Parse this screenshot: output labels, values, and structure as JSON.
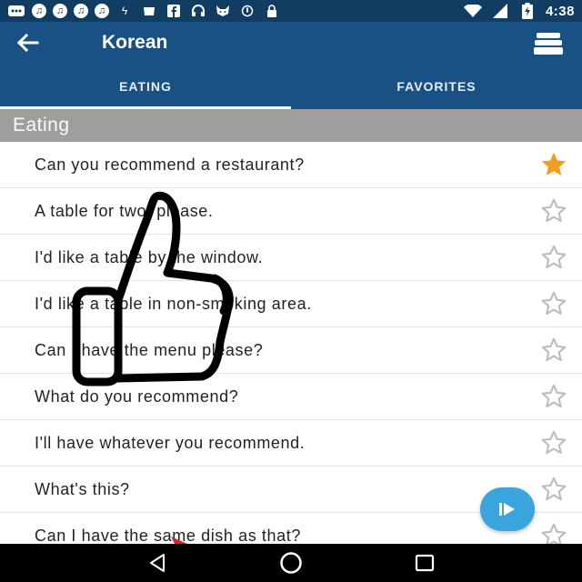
{
  "status_bar": {
    "time": "4:38",
    "icons": [
      "notification-icon",
      "music-icon",
      "music-icon",
      "music-icon",
      "music-icon",
      "usb-icon",
      "wallet-icon",
      "facebook-icon",
      "headset-icon",
      "cat-icon",
      "sync-icon",
      "lock-icon",
      "wifi-icon",
      "signal-icon",
      "battery-charging-icon"
    ]
  },
  "app_bar": {
    "title": "Korean",
    "back_icon": "arrow-back-icon",
    "menu_icon": "stack-icon"
  },
  "tabs": [
    {
      "label": "EATING",
      "active": true
    },
    {
      "label": "FAVORITES",
      "active": false
    }
  ],
  "section": {
    "title": "Eating"
  },
  "phrases": [
    {
      "text": "Can you recommend a restaurant?",
      "favorite": true
    },
    {
      "text": "A table for two, please.",
      "favorite": false
    },
    {
      "text": "I'd like a table by the window.",
      "favorite": false
    },
    {
      "text": "I'd like a table in non-smoking area.",
      "favorite": false
    },
    {
      "text": "Can I have the menu please?",
      "favorite": false
    },
    {
      "text": "What do you recommend?",
      "favorite": false
    },
    {
      "text": "I'll have whatever you recommend.",
      "favorite": false
    },
    {
      "text": "What's this?",
      "favorite": false
    },
    {
      "text": "Can I have the same dish as that?",
      "favorite": false
    }
  ],
  "colors": {
    "app_bar": "#1a5185",
    "status_bar": "#123d63",
    "section_header": "#9e9e9e",
    "star_active": "#f39c22",
    "star_inactive": "#bdbdbd",
    "fab": "#3aa4dc"
  },
  "fab": {
    "icon": "play-icon"
  },
  "nav_bar": {
    "icons": [
      "back-icon",
      "home-icon",
      "recents-icon"
    ]
  }
}
